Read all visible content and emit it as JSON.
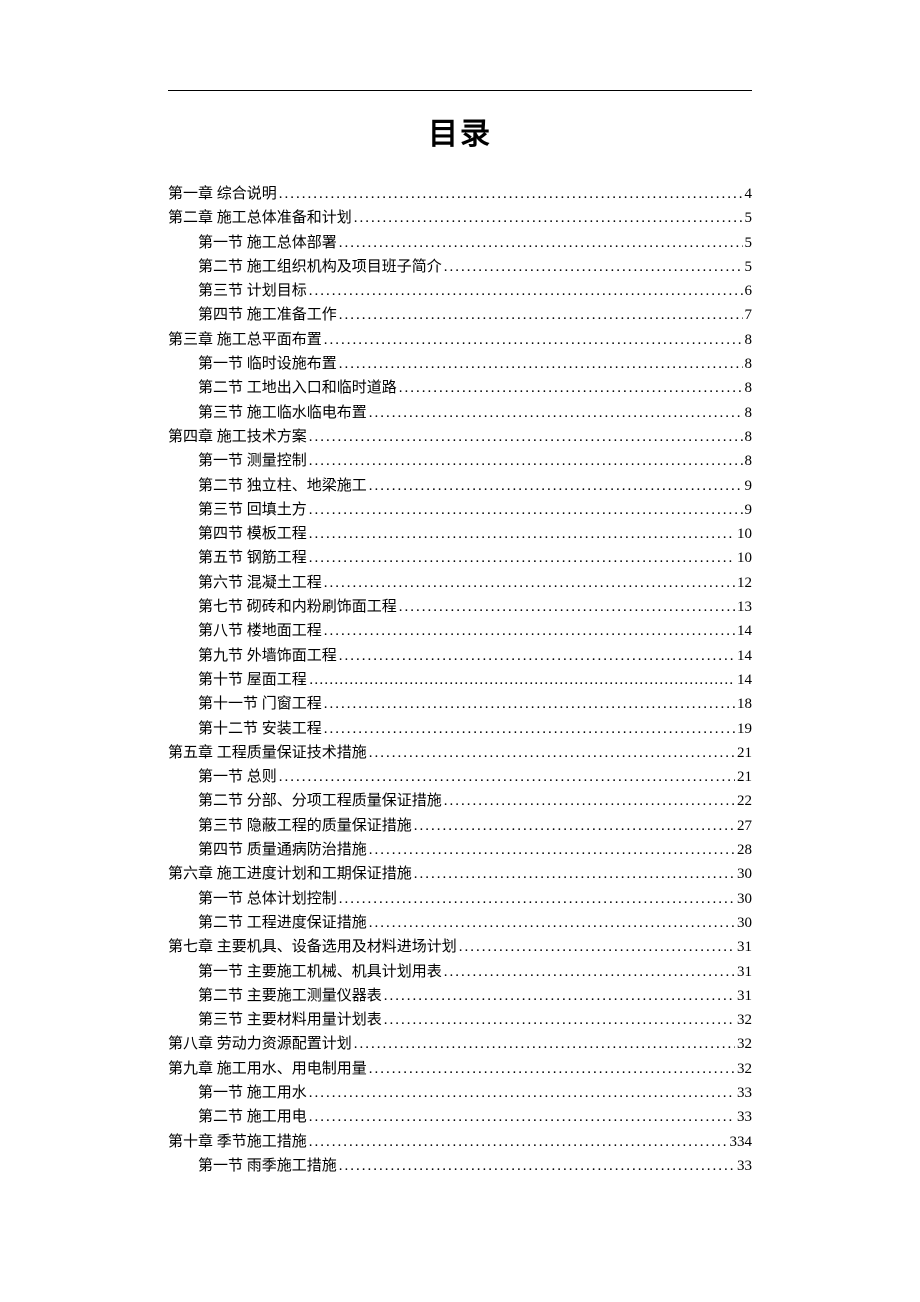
{
  "title": "目录",
  "toc": [
    {
      "level": 1,
      "label": "第一章 综合说明",
      "page": "4",
      "leader": "dots"
    },
    {
      "level": 1,
      "label": "第二章 施工总体准备和计划",
      "page": "5",
      "leader": "dots"
    },
    {
      "level": 2,
      "label": "第一节 施工总体部署",
      "page": "5",
      "leader": "dots"
    },
    {
      "level": 2,
      "label": "第二节 施工组织机构及项目班子简介",
      "page": "5",
      "leader": "dots"
    },
    {
      "level": 2,
      "label": "第三节 计划目标",
      "page": "6",
      "leader": "dots"
    },
    {
      "level": 2,
      "label": "第四节 施工准备工作",
      "page": "7",
      "leader": "dots"
    },
    {
      "level": 1,
      "label": "第三章 施工总平面布置",
      "page": "8",
      "leader": "dots"
    },
    {
      "level": 2,
      "label": "第一节 临时设施布置",
      "page": "8",
      "leader": "dots"
    },
    {
      "level": 2,
      "label": "第二节 工地出入口和临时道路",
      "page": "8",
      "leader": "dots"
    },
    {
      "level": 2,
      "label": "第三节 施工临水临电布置",
      "page": "8",
      "leader": "dots"
    },
    {
      "level": 1,
      "label": "第四章 施工技术方案",
      "page": "8",
      "leader": "dots"
    },
    {
      "level": 2,
      "label": "第一节 测量控制",
      "page": "8",
      "leader": "dots"
    },
    {
      "level": 2,
      "label": "第二节 独立柱、地梁施工",
      "page": "9",
      "leader": "dots"
    },
    {
      "level": 2,
      "label": "第三节 回填土方",
      "page": "9",
      "leader": "dots"
    },
    {
      "level": 2,
      "label": "第四节 模板工程",
      "page": "10",
      "leader": "dots"
    },
    {
      "level": 2,
      "label": "第五节 钢筋工程",
      "page": "10",
      "leader": "dots"
    },
    {
      "level": 2,
      "label": "第六节 混凝土工程",
      "page": "12",
      "leader": "dots"
    },
    {
      "level": 2,
      "label": "第七节 砌砖和内粉刷饰面工程",
      "page": "13",
      "leader": "dots"
    },
    {
      "level": 2,
      "label": "第八节 楼地面工程",
      "page": "14",
      "leader": "dots"
    },
    {
      "level": 2,
      "label": "第九节 外墙饰面工程",
      "page": "14",
      "leader": "dots"
    },
    {
      "level": 2,
      "label": " 第十节 屋面工程",
      "page": "14",
      "leader": "ellipsis"
    },
    {
      "level": 2,
      "label": "第十一节 门窗工程",
      "page": "18",
      "leader": "dots"
    },
    {
      "level": 2,
      "label": "第十二节 安装工程",
      "page": "19",
      "leader": "dots"
    },
    {
      "level": 1,
      "label": "第五章 工程质量保证技术措施",
      "page": "21",
      "leader": "dots"
    },
    {
      "level": 2,
      "label": "第一节 总则",
      "page": "21",
      "leader": "dots"
    },
    {
      "level": 2,
      "label": "第二节 分部、分项工程质量保证措施",
      "page": "22",
      "leader": "dots"
    },
    {
      "level": 2,
      "label": "第三节 隐蔽工程的质量保证措施",
      "page": "27",
      "leader": "dots"
    },
    {
      "level": 2,
      "label": "第四节 质量通病防治措施",
      "page": "28",
      "leader": "dots"
    },
    {
      "level": 1,
      "label": "第六章 施工进度计划和工期保证措施",
      "page": "30",
      "leader": "dots"
    },
    {
      "level": 2,
      "label": "第一节 总体计划控制",
      "page": "30",
      "leader": "dots"
    },
    {
      "level": 2,
      "label": "第二节 工程进度保证措施",
      "page": "30",
      "leader": "dots"
    },
    {
      "level": 1,
      "label": "第七章 主要机具、设备选用及材料进场计划",
      "page": "31",
      "leader": "dots"
    },
    {
      "level": 2,
      "label": "第一节 主要施工机械、机具计划用表",
      "page": "31",
      "leader": "dots"
    },
    {
      "level": 2,
      "label": "第二节 主要施工测量仪器表",
      "page": "31",
      "leader": "dots"
    },
    {
      "level": 2,
      "label": "第三节 主要材料用量计划表",
      "page": "32",
      "leader": "dots"
    },
    {
      "level": 1,
      "label": "第八章 劳动力资源配置计划",
      "page": "32",
      "leader": "dots"
    },
    {
      "level": 1,
      "label": "第九章 施工用水、用电制用量",
      "page": "32",
      "leader": "dots"
    },
    {
      "level": 2,
      "label": "第一节 施工用水",
      "page": "33",
      "leader": "dots"
    },
    {
      "level": 2,
      "label": "第二节 施工用电",
      "page": "33",
      "leader": "dots"
    },
    {
      "level": 1,
      "label": "第十章 季节施工措施",
      "page": "334",
      "leader": "dots"
    },
    {
      "level": 2,
      "label": "第一节 雨季施工措施",
      "page": "33",
      "leader": "dots"
    }
  ]
}
